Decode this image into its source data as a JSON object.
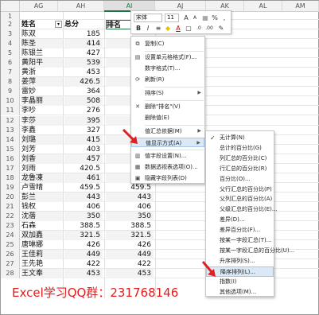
{
  "columns": [
    "AG",
    "AH",
    "AI",
    "AJ",
    "AK",
    "AL",
    "AM"
  ],
  "rows": [
    {
      "n": "1",
      "name": "",
      "total": "",
      "rank": ""
    },
    {
      "n": "2",
      "name": "姓名",
      "total": "总分",
      "rank": "排名"
    },
    {
      "n": "3",
      "name": "陈双",
      "total": "185",
      "rank": ""
    },
    {
      "n": "4",
      "name": "陈圣",
      "total": "414",
      "rank": ""
    },
    {
      "n": "5",
      "name": "陈银兰",
      "total": "427",
      "rank": ""
    },
    {
      "n": "6",
      "name": "黄阳平",
      "total": "539",
      "rank": ""
    },
    {
      "n": "7",
      "name": "黄浙",
      "total": "453",
      "rank": ""
    },
    {
      "n": "8",
      "name": "姜萍",
      "total": "426.5",
      "rank": ""
    },
    {
      "n": "9",
      "name": "雷妙",
      "total": "364",
      "rank": ""
    },
    {
      "n": "10",
      "name": "李晶丽",
      "total": "508",
      "rank": ""
    },
    {
      "n": "11",
      "name": "李吵",
      "total": "276",
      "rank": ""
    },
    {
      "n": "12",
      "name": "李莎",
      "total": "395",
      "rank": ""
    },
    {
      "n": "13",
      "name": "李鑫",
      "total": "327",
      "rank": ""
    },
    {
      "n": "14",
      "name": "刘璐",
      "total": "415",
      "rank": ""
    },
    {
      "n": "15",
      "name": "刘芳",
      "total": "403",
      "rank": ""
    },
    {
      "n": "16",
      "name": "刘香",
      "total": "457",
      "rank": ""
    },
    {
      "n": "17",
      "name": "刘雨",
      "total": "420.5",
      "rank": "420.5"
    },
    {
      "n": "18",
      "name": "龙魯凍",
      "total": "461",
      "rank": "461"
    },
    {
      "n": "19",
      "name": "卢雪晴",
      "total": "459.5",
      "rank": "459.5"
    },
    {
      "n": "20",
      "name": "彭兰",
      "total": "443",
      "rank": "443"
    },
    {
      "n": "21",
      "name": "钱权",
      "total": "406",
      "rank": "406"
    },
    {
      "n": "22",
      "name": "沈蓓",
      "total": "350",
      "rank": "350"
    },
    {
      "n": "23",
      "name": "石森",
      "total": "388.5",
      "rank": "388.5"
    },
    {
      "n": "24",
      "name": "双加鑫",
      "total": "321.5",
      "rank": "321.5"
    },
    {
      "n": "25",
      "name": "唐琳娜",
      "total": "426",
      "rank": "426"
    },
    {
      "n": "26",
      "name": "王佳莉",
      "total": "449",
      "rank": "449"
    },
    {
      "n": "27",
      "name": "王先艳",
      "total": "422",
      "rank": "422"
    },
    {
      "n": "28",
      "name": "王文奉",
      "total": "453",
      "rank": "453"
    }
  ],
  "mini_toolbar": {
    "font": "宋体",
    "size": "11",
    "bold": "B",
    "italic": "I",
    "underline_a": "A",
    "percent": "%",
    "comma": ","
  },
  "context_menu": [
    {
      "label": "复制(C)",
      "icon": "copy-icon"
    },
    {
      "label": "设置单元格格式(F)...",
      "icon": "format-cells-icon"
    },
    {
      "label": "数字格式(T)...",
      "icon": ""
    },
    {
      "label": "刷新(R)",
      "icon": "refresh-icon"
    },
    {
      "label": "排序(S)",
      "icon": "",
      "sub": true
    },
    {
      "label": "删除\"排名\"(V)",
      "icon": "delete-icon"
    },
    {
      "label": "删除值(E)",
      "icon": ""
    },
    {
      "label": "值汇总依据(M)",
      "icon": "",
      "sub": true
    },
    {
      "label": "值显示方式(A)",
      "icon": "",
      "sub": true,
      "hi": true
    },
    {
      "label": "值字段设置(N)...",
      "icon": "field-settings-icon"
    },
    {
      "label": "数据透视表选项(O)...",
      "icon": "pivot-options-icon"
    },
    {
      "label": "隐藏字段列表(D)",
      "icon": "field-list-icon"
    }
  ],
  "submenu": [
    {
      "label": "无计算(N)",
      "checked": true
    },
    {
      "label": "总计的百分比(G)"
    },
    {
      "label": "列汇总的百分比(C)"
    },
    {
      "label": "行汇总的百分比(R)"
    },
    {
      "label": "百分比(O)..."
    },
    {
      "label": "父行汇总的百分比(P)"
    },
    {
      "label": "父列汇总的百分比(A)"
    },
    {
      "label": "父级汇总的百分比(E)..."
    },
    {
      "label": "差异(D)..."
    },
    {
      "label": "差异百分比(F)..."
    },
    {
      "label": "按某一字段汇总(T)..."
    },
    {
      "label": "按某一字段汇总的百分比(U)..."
    },
    {
      "label": "升序排列(S)..."
    },
    {
      "label": "降序排列(L)...",
      "hi": true
    },
    {
      "label": "指数(I)"
    },
    {
      "label": "其他选项(M)..."
    }
  ],
  "caption": "Excel学习QQ群：231768146"
}
